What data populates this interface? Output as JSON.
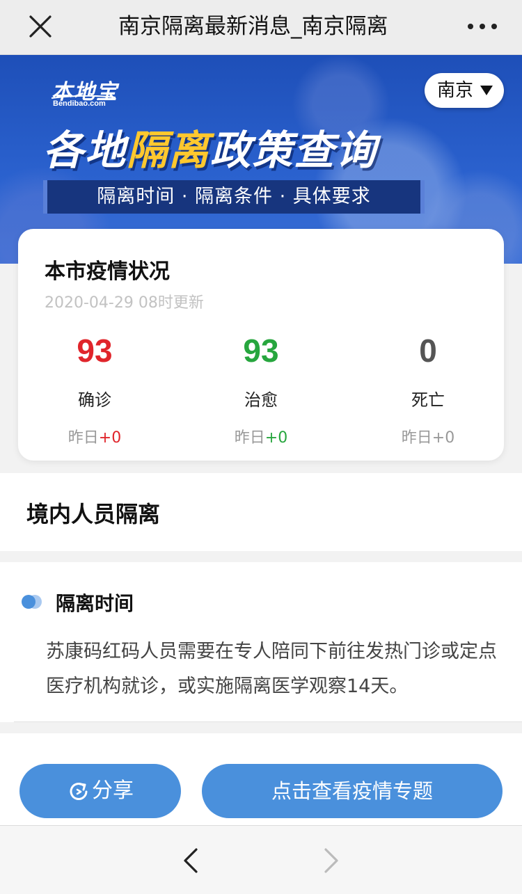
{
  "topbar": {
    "title": "南京隔离最新消息_南京隔离",
    "close_icon": "close-icon",
    "more_icon": "more-icon"
  },
  "banner": {
    "logo_text": "本地宝",
    "logo_sub": "Bendibao.com",
    "city": "南京",
    "title_part1": "各地",
    "title_highlight": "隔离",
    "title_part2": "政策查询",
    "tagline": "隔离时间 · 隔离条件 · 具体要求",
    "colors": {
      "highlight": "#ffc82e",
      "tag_bg": "#17357e"
    }
  },
  "stats": {
    "title": "本市疫情状况",
    "updated": "2020-04-29 08时更新",
    "items": [
      {
        "value": "93",
        "label": "确诊",
        "delta_prefix": "昨日",
        "delta": "+0",
        "color": "#e0252b"
      },
      {
        "value": "93",
        "label": "治愈",
        "delta_prefix": "昨日",
        "delta": "+0",
        "color": "#27a63e"
      },
      {
        "value": "0",
        "label": "死亡",
        "delta_prefix": "昨日",
        "delta": "+0",
        "color": "#555555"
      }
    ]
  },
  "section": {
    "title": "境内人员隔离"
  },
  "content": {
    "subtitle": "隔离时间",
    "body": "苏康码红码人员需要在专人陪同下前往发热门诊或定点医疗机构就诊，或实施隔离医学观察14天。"
  },
  "actions": {
    "share_label": "分享",
    "share_icon": "share-icon",
    "topic_label": "点击查看疫情专题",
    "button_color": "#4a90dc"
  },
  "bottom_nav": {
    "back_icon": "chevron-left-icon",
    "forward_icon": "chevron-right-icon"
  }
}
